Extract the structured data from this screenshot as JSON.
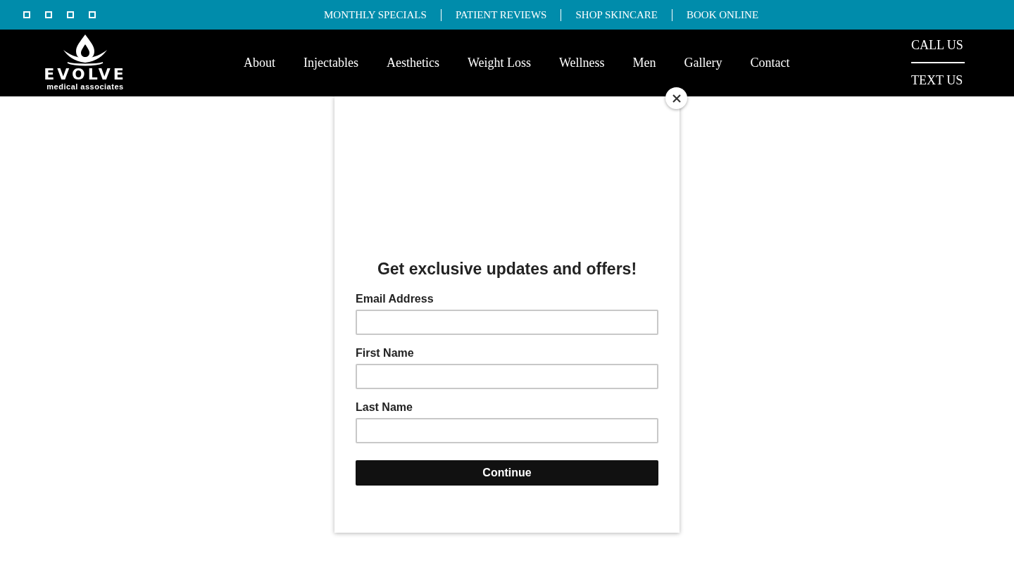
{
  "top_bar": {
    "links": [
      "MONTHLY SPECIALS",
      "PATIENT REVIEWS",
      "SHOP SKINCARE",
      "BOOK ONLINE"
    ]
  },
  "header": {
    "logo": {
      "name": "EVOLVE",
      "tagline": "medical associates"
    },
    "nav": [
      "About",
      "Injectables",
      "Aesthetics",
      "Weight Loss",
      "Wellness",
      "Men",
      "Gallery",
      "Contact"
    ],
    "contact": [
      "CALL US",
      "TEXT US"
    ]
  },
  "popup": {
    "heading": "Get exclusive updates and offers!",
    "fields": [
      {
        "label": "Email Address"
      },
      {
        "label": "First Name"
      },
      {
        "label": "Last Name"
      }
    ],
    "button": "Continue"
  }
}
